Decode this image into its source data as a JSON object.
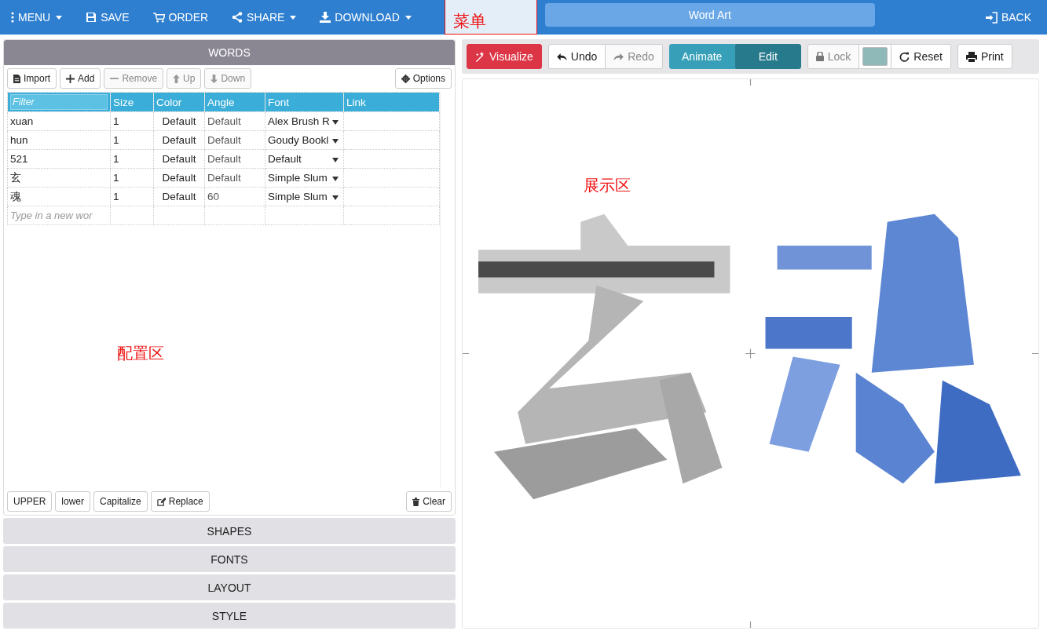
{
  "menu_bar": {
    "items": [
      {
        "label": "MENU",
        "kind": "menu",
        "dropdown": true
      },
      {
        "label": "SAVE",
        "kind": "save",
        "dropdown": false
      },
      {
        "label": "ORDER",
        "kind": "order",
        "dropdown": false
      },
      {
        "label": "SHARE",
        "kind": "share",
        "dropdown": true
      },
      {
        "label": "DOWNLOAD",
        "kind": "download",
        "dropdown": true
      }
    ],
    "annotation": "菜单",
    "title": "Word Art",
    "back": "BACK"
  },
  "words_panel": {
    "title": "WORDS",
    "toolbar": [
      {
        "label": "Import",
        "kind": "import",
        "disabled": false
      },
      {
        "label": "Add",
        "kind": "add",
        "disabled": false
      },
      {
        "label": "Remove",
        "kind": "remove",
        "disabled": true
      },
      {
        "label": "Up",
        "kind": "up",
        "disabled": true
      },
      {
        "label": "Down",
        "kind": "down",
        "disabled": true
      }
    ],
    "options": "Options",
    "table": {
      "filter_placeholder": "Filter",
      "columns": [
        "Size",
        "Color",
        "Angle",
        "Font",
        "Link"
      ],
      "rows": [
        {
          "word": "xuan",
          "size": "1",
          "color_setting": "Default",
          "angle": "Default",
          "font": "Alex Brush R"
        },
        {
          "word": "hun",
          "size": "1",
          "color_setting": "Default",
          "angle": "Default",
          "font": "Goudy Bookl"
        },
        {
          "word": "521",
          "size": "1",
          "color_setting": "Default",
          "angle": "Default",
          "font": "Default"
        },
        {
          "word": "玄",
          "size": "1",
          "color_setting": "Default",
          "angle": "Default",
          "font": "Simple Slum"
        },
        {
          "word": "魂",
          "size": "1",
          "color_setting": "Default",
          "angle": "60",
          "font": "Simple Slum"
        }
      ],
      "new_word_placeholder": "Type in a new wor"
    },
    "annotation": "配置区",
    "case_buttons": [
      {
        "label": "UPPER",
        "kind": "plain"
      },
      {
        "label": "lower",
        "kind": "plain"
      },
      {
        "label": "Capitalize",
        "kind": "plain"
      },
      {
        "label": "Replace",
        "kind": "replace"
      }
    ],
    "clear": "Clear"
  },
  "sections": [
    "SHAPES",
    "FONTS",
    "LAYOUT",
    "STYLE"
  ],
  "canvas_toolbar": {
    "visualize": "Visualize",
    "undo": {
      "label": "Undo",
      "disabled": false
    },
    "redo": {
      "label": "Redo",
      "disabled": true
    },
    "modes": [
      {
        "label": "Animate",
        "selected": false
      },
      {
        "label": "Edit",
        "selected": true
      }
    ],
    "lock": {
      "label": "Lock",
      "disabled": true
    },
    "swatch": {
      "color": "#8fb8b8"
    },
    "reset": "Reset",
    "print": "Print"
  },
  "canvas": {
    "kind": "picture",
    "annotation": "展示区"
  }
}
